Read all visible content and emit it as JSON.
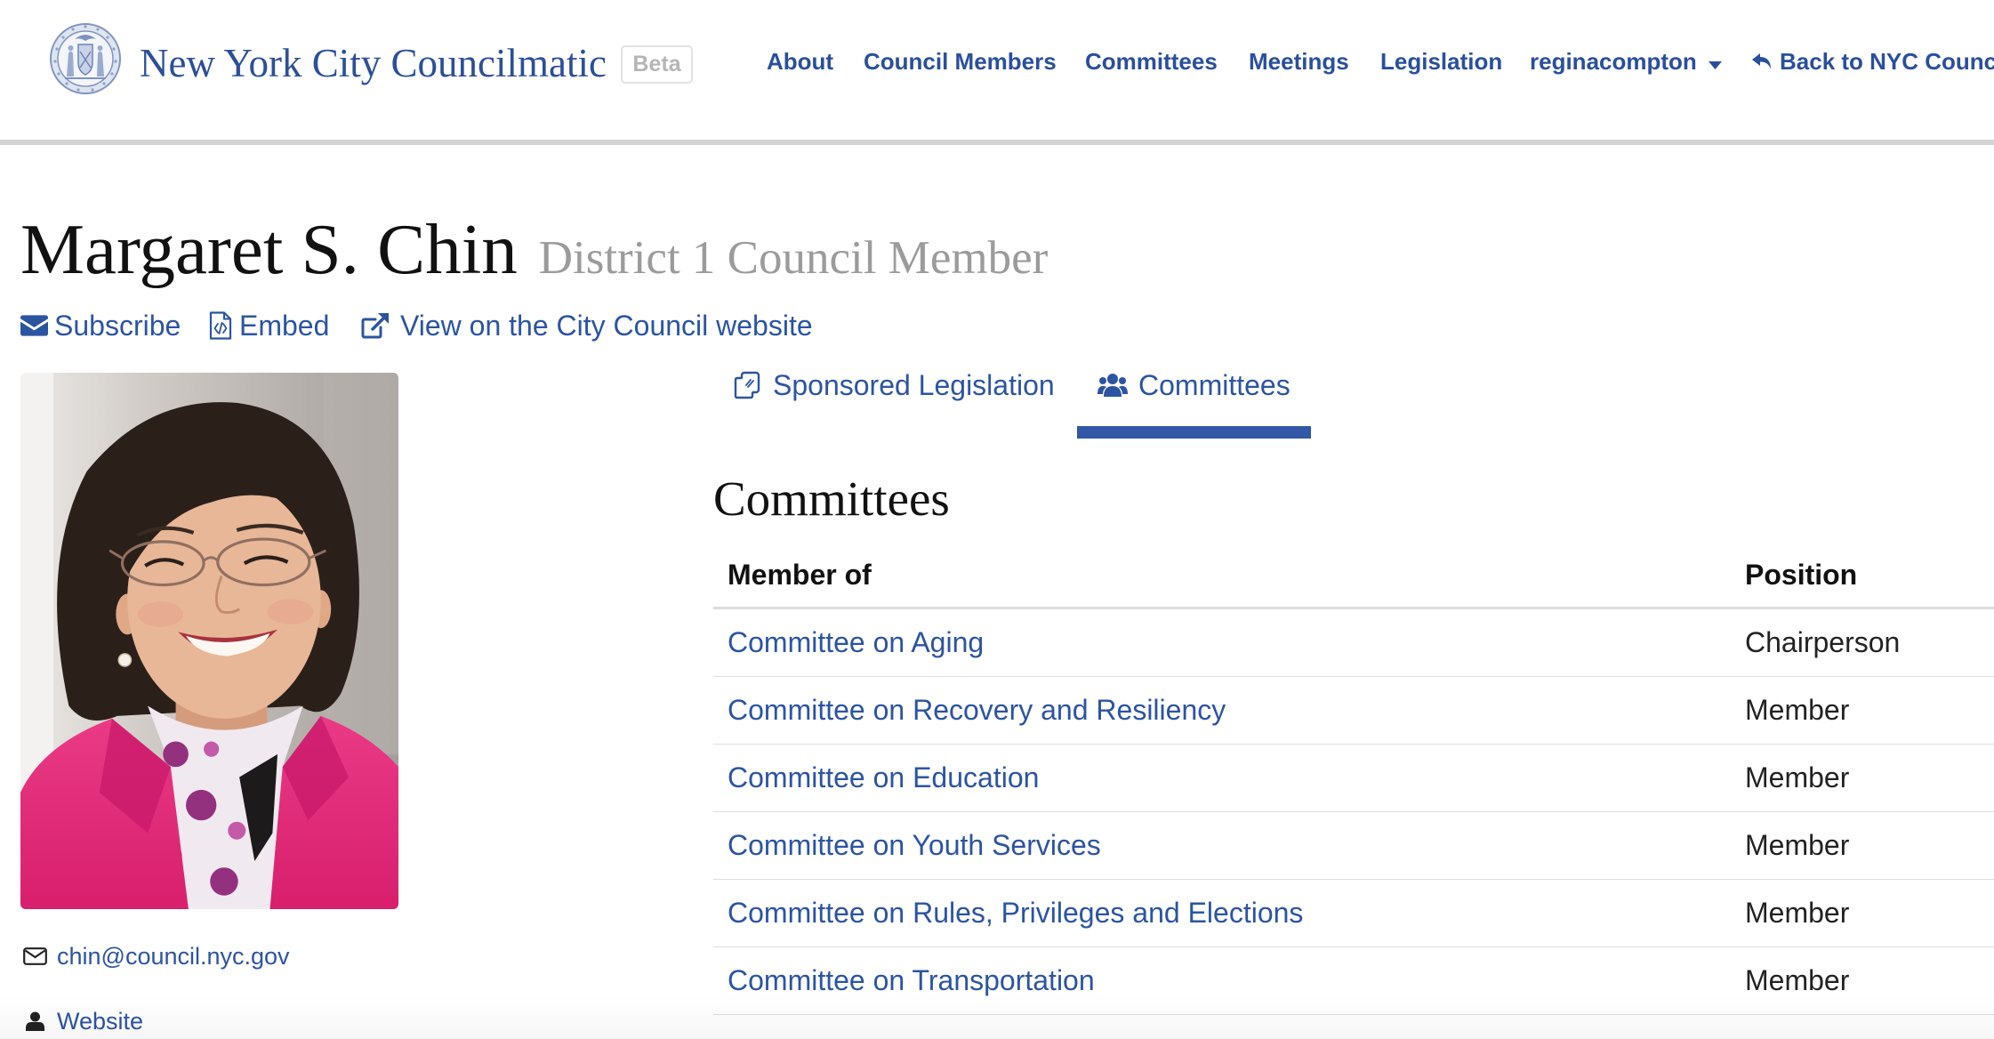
{
  "header": {
    "logo_icon": "nyc-seal-icon",
    "brand": "New York City Councilmatic",
    "badge": "Beta",
    "nav": [
      {
        "label": "About"
      },
      {
        "label": "Council Members"
      },
      {
        "label": "Committees"
      },
      {
        "label": "Meetings"
      },
      {
        "label": "Legislation"
      },
      {
        "label": "reginacompton",
        "icon": "caret-down-icon"
      },
      {
        "label": "Back to NYC Counci",
        "icon": "reply-icon"
      }
    ]
  },
  "member": {
    "name": "Margaret S. Chin",
    "role": "District 1 Council Member",
    "actions": [
      {
        "label": "Subscribe",
        "icon": "envelope-icon"
      },
      {
        "label": "Embed",
        "icon": "file-code-icon"
      },
      {
        "label": "View on the City Council website",
        "icon": "external-link-icon"
      }
    ],
    "contact": {
      "email": "chin@council.nyc.gov",
      "email_icon": "envelope-outline-icon",
      "website": "Website",
      "website_icon": "user-icon"
    }
  },
  "tabs": [
    {
      "label": "Sponsored Legislation",
      "icon": "copy-icon",
      "active": false
    },
    {
      "label": "Committees",
      "icon": "users-icon",
      "active": true
    }
  ],
  "committees": {
    "heading": "Committees",
    "columns": {
      "committee": "Member of",
      "position": "Position"
    },
    "rows": [
      {
        "committee": "Committee on Aging",
        "position": "Chairperson"
      },
      {
        "committee": "Committee on Recovery and Resiliency",
        "position": "Member"
      },
      {
        "committee": "Committee on Education",
        "position": "Member"
      },
      {
        "committee": "Committee on Youth Services",
        "position": "Member"
      },
      {
        "committee": "Committee on Rules, Privileges and Elections",
        "position": "Member"
      },
      {
        "committee": "Committee on Transportation",
        "position": "Member"
      }
    ]
  },
  "colors": {
    "brand": "#2c4f98",
    "nav": "#2a4f9c",
    "link": "#2c54a1",
    "active": "#3157a6",
    "muted": "#9b9b9b"
  }
}
